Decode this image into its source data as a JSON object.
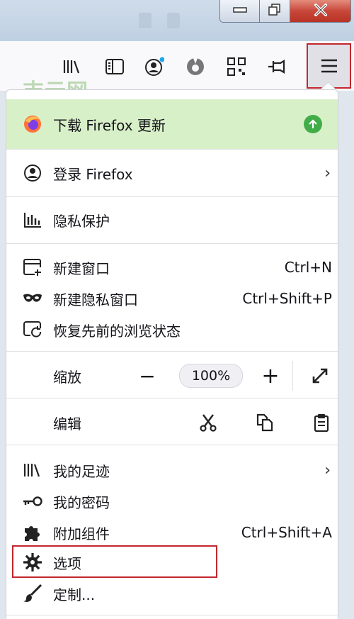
{
  "watermark": "吉云网",
  "window_controls": [
    "minimize-icon",
    "maximize-icon",
    "close-icon"
  ],
  "toolbar": {
    "icons": [
      "library-icon",
      "sidebar-icon",
      "account-icon",
      "pocket-icon",
      "qr-code-icon",
      "pin-icon",
      "hamburger-menu-icon"
    ]
  },
  "menu": {
    "update": {
      "label": "下载 Firefox 更新",
      "icon": "firefox-logo-icon",
      "badge": "update-arrow-icon"
    },
    "signin": {
      "label": "登录 Firefox",
      "icon": "account-circle-icon"
    },
    "privacy": {
      "label": "隐私保护",
      "icon": "privacy-chart-icon"
    },
    "new_window": {
      "label": "新建窗口",
      "shortcut": "Ctrl+N",
      "icon": "new-window-icon"
    },
    "private_window": {
      "label": "新建隐私窗口",
      "shortcut": "Ctrl+Shift+P",
      "icon": "mask-icon"
    },
    "restore": {
      "label": "恢复先前的浏览状态",
      "icon": "restore-session-icon"
    },
    "zoom": {
      "label": "缩放",
      "minus": "−",
      "value": "100%",
      "plus": "+",
      "fullscreen_icon": "expand-icon"
    },
    "edit": {
      "label": "编辑",
      "icons": [
        "cut-icon",
        "copy-icon",
        "paste-icon"
      ]
    },
    "library": {
      "label": "我的足迹",
      "icon": "library-icon"
    },
    "passwords": {
      "label": "我的密码",
      "icon": "key-icon"
    },
    "addons": {
      "label": "附加组件",
      "shortcut": "Ctrl+Shift+A",
      "icon": "puzzle-icon"
    },
    "options": {
      "label": "选项",
      "icon": "gear-icon"
    },
    "customize": {
      "label": "定制...",
      "icon": "brush-icon"
    }
  },
  "colors": {
    "highlight_border": "#c4262e",
    "update_bg": "#d8f0c8",
    "update_badge": "#41ad49"
  }
}
